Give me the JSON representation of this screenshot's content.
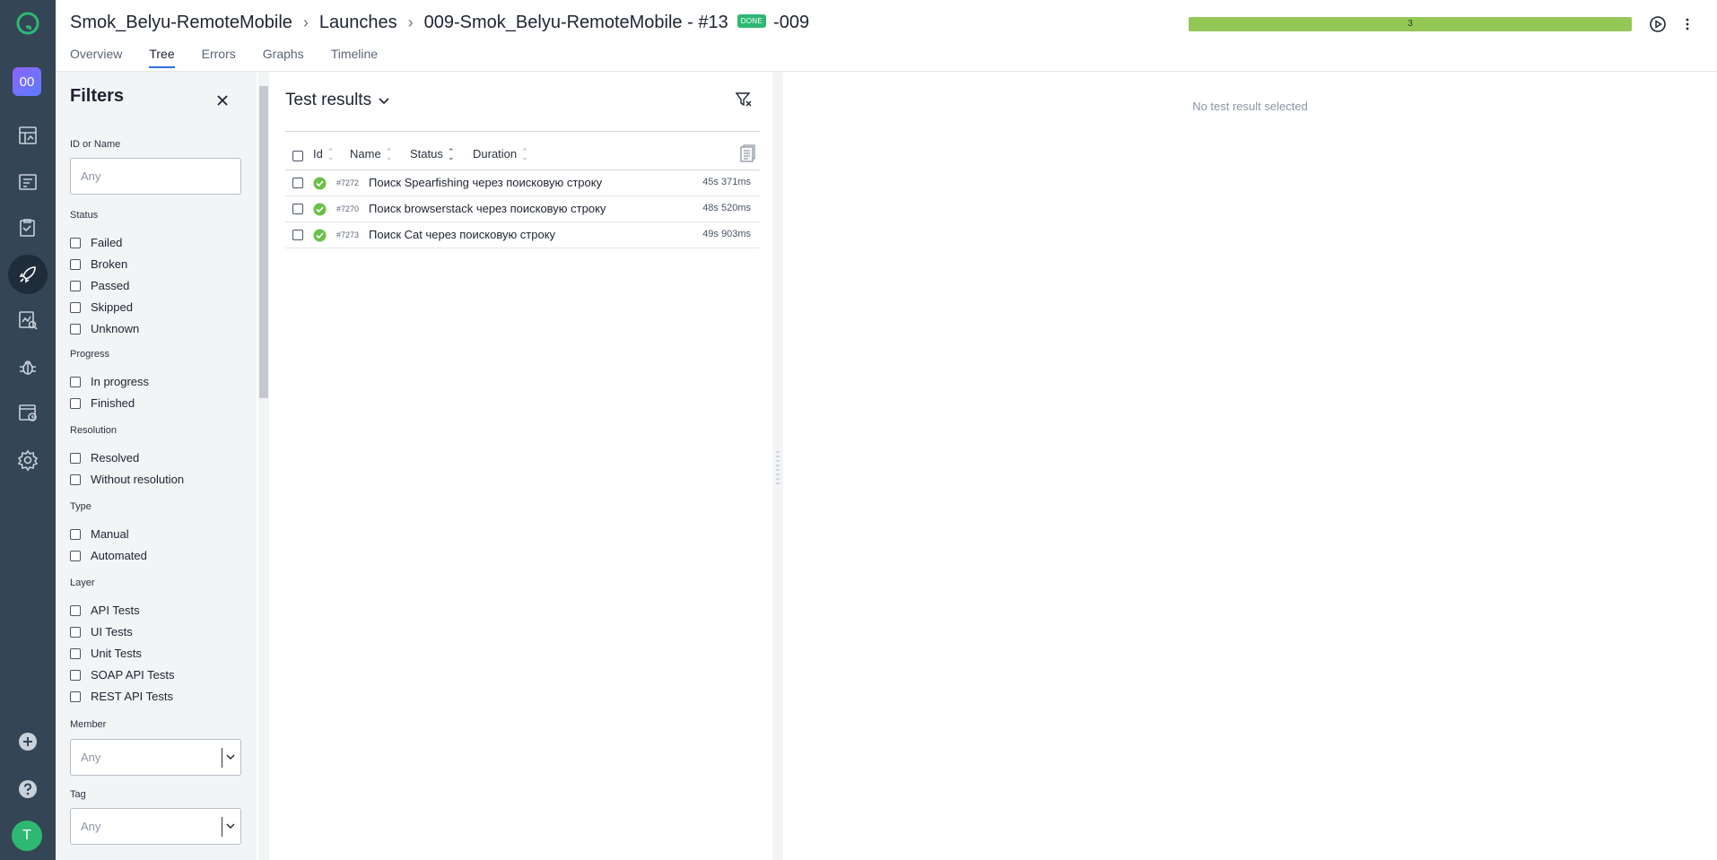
{
  "header": {
    "breadcrumbs": [
      "Smok_Belyu-RemoteMobile",
      "Launches",
      "009-Smok_Belyu-RemoteMobile - #13"
    ],
    "status_badge": "DONE",
    "suffix": "-009",
    "progress_label": "3",
    "progress_fraction": 1.0,
    "progress_color": "#95c757",
    "tabs": [
      {
        "label": "Overview",
        "active": false
      },
      {
        "label": "Tree",
        "active": true
      },
      {
        "label": "Errors",
        "active": false
      },
      {
        "label": "Graphs",
        "active": false
      },
      {
        "label": "Timeline",
        "active": false
      }
    ]
  },
  "rail": {
    "project_badge": "00",
    "avatar_initial": "T",
    "icons": [
      "app-logo-icon",
      "dashboard-icon",
      "test-cases-icon",
      "test-plans-icon",
      "launches-icon",
      "analytics-icon",
      "defects-icon",
      "jobs-icon",
      "settings-icon",
      "add-icon",
      "help-icon"
    ]
  },
  "filters": {
    "title": "Filters",
    "id_name": {
      "label": "ID or Name",
      "placeholder": "Any"
    },
    "status": {
      "label": "Status",
      "options": [
        "Failed",
        "Broken",
        "Passed",
        "Skipped",
        "Unknown"
      ]
    },
    "progress": {
      "label": "Progress",
      "options": [
        "In progress",
        "Finished"
      ]
    },
    "resolution": {
      "label": "Resolution",
      "options": [
        "Resolved",
        "Without resolution"
      ]
    },
    "type": {
      "label": "Type",
      "options": [
        "Manual",
        "Automated"
      ]
    },
    "layer": {
      "label": "Layer",
      "options": [
        "API Tests",
        "UI Tests",
        "Unit Tests",
        "SOAP API Tests",
        "REST API Tests"
      ]
    },
    "member": {
      "label": "Member",
      "placeholder": "Any"
    },
    "tag": {
      "label": "Tag",
      "placeholder": "Any"
    }
  },
  "results": {
    "title": "Test results",
    "columns": [
      "Id",
      "Name",
      "Status",
      "Duration"
    ],
    "rows": [
      {
        "id": "#7272",
        "name": "Поиск Spearfishing через поисковую строку",
        "duration": "45s 371ms",
        "status": "passed"
      },
      {
        "id": "#7270",
        "name": "Поиск browserstack через поисковую строку",
        "duration": "48s 520ms",
        "status": "passed"
      },
      {
        "id": "#7273",
        "name": "Поиск Cat через поисковую строку",
        "duration": "49s 903ms",
        "status": "passed"
      }
    ]
  },
  "detail": {
    "empty_text": "No test result selected"
  },
  "colors": {
    "rail_bg": "#344556",
    "accent": "#2f6fe0",
    "passed": "#6cc04a",
    "done_badge": "#2eb872"
  }
}
